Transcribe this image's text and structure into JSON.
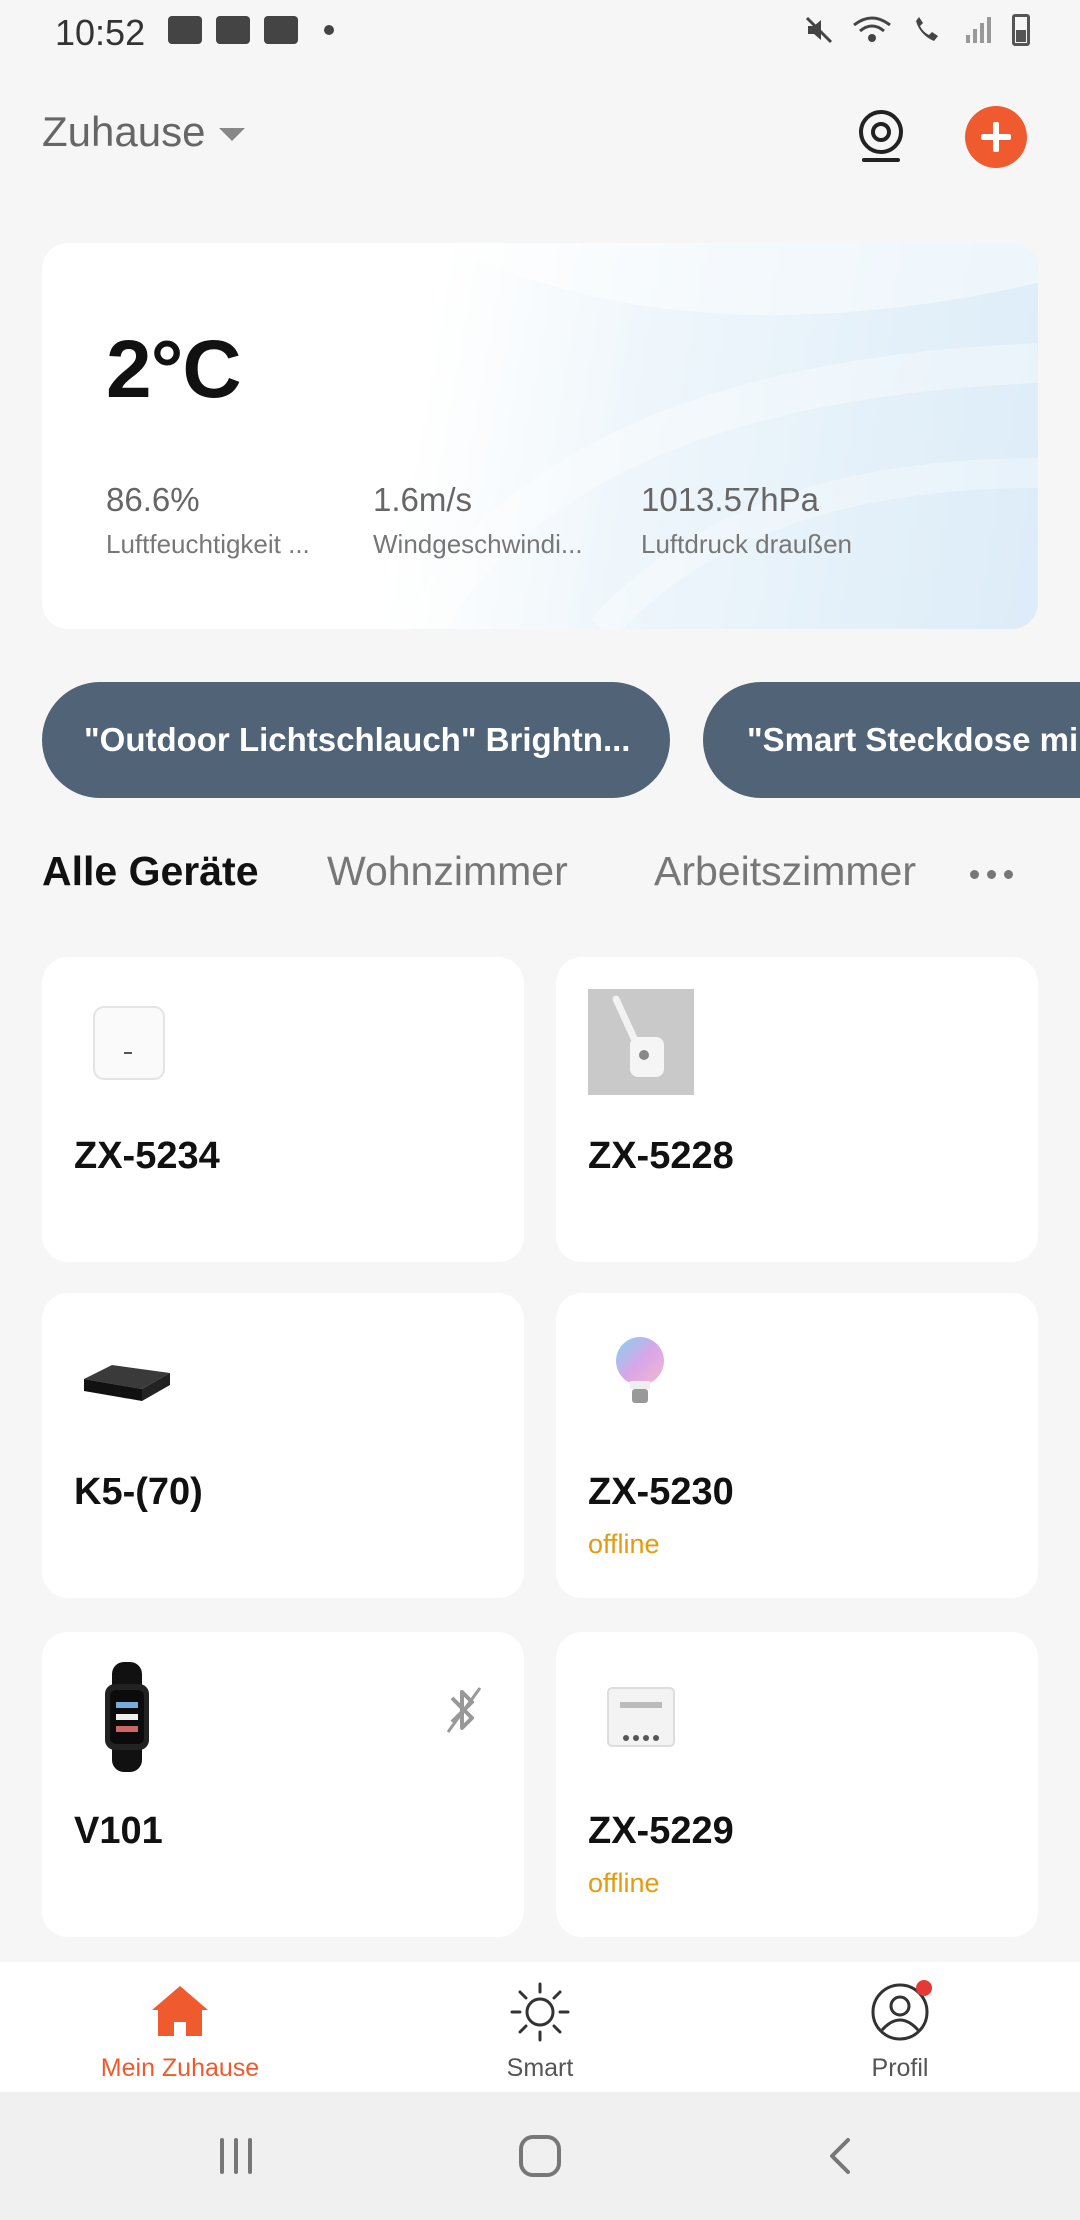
{
  "status_bar": {
    "time": "10:52"
  },
  "header": {
    "home_name": "Zuhause"
  },
  "weather": {
    "temperature": "2°C",
    "stats": [
      {
        "value": "86.6%",
        "label": "Luftfeuchtigkeit ..."
      },
      {
        "value": "1.6m/s",
        "label": "Windgeschwindi..."
      },
      {
        "value": "1013.57hPa",
        "label": "Luftdruck draußen"
      }
    ]
  },
  "scenes": [
    {
      "label": "\"Outdoor Lichtschlauch\" Brightn..."
    },
    {
      "label": "\"Smart Steckdose mi"
    }
  ],
  "rooms": {
    "tabs": [
      {
        "label": "Alle Geräte",
        "active": true
      },
      {
        "label": "Wohnzimmer",
        "active": false
      },
      {
        "label": "Arbeitszimmer",
        "active": false
      }
    ]
  },
  "devices": [
    {
      "name": "ZX-5234",
      "status": "",
      "image": "hub-icon"
    },
    {
      "name": "ZX-5228",
      "status": "",
      "image": "hose-light-icon"
    },
    {
      "name": "K5-(70)",
      "status": "",
      "image": "black-box-icon"
    },
    {
      "name": "ZX-5230",
      "status": "offline",
      "image": "bulb-icon"
    },
    {
      "name": "V101",
      "status": "",
      "image": "fitness-band-icon",
      "bluetooth_off": true
    },
    {
      "name": "ZX-5229",
      "status": "offline",
      "image": "plug-module-icon"
    }
  ],
  "bottom_nav": {
    "items": [
      {
        "label": "Mein Zuhause",
        "active": true
      },
      {
        "label": "Smart",
        "active": false
      },
      {
        "label": "Profil",
        "active": false,
        "badge": true
      }
    ]
  },
  "colors": {
    "accent": "#ef5a2e",
    "offline": "#e59a0f",
    "pill": "#506377",
    "background": "#f6f6f6"
  }
}
